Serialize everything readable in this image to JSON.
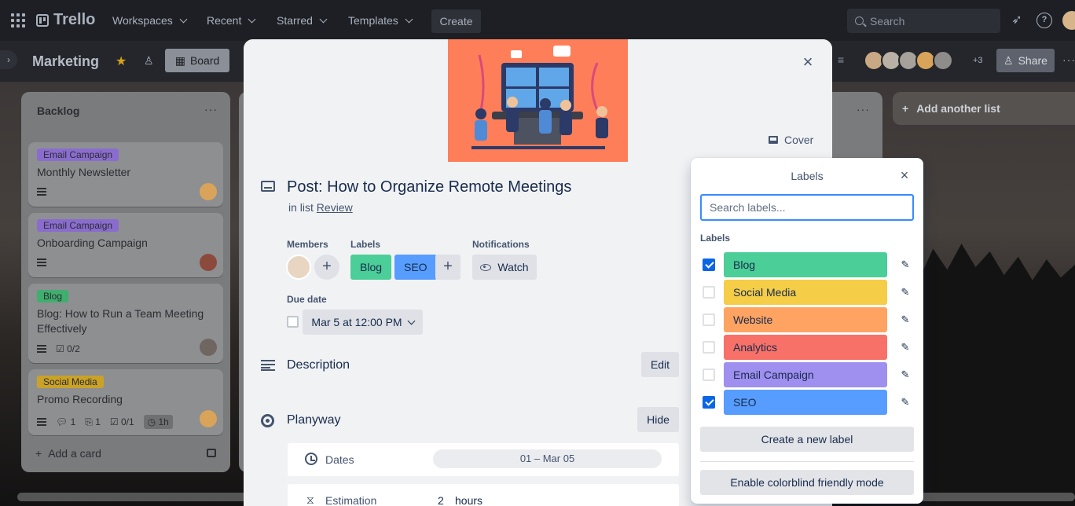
{
  "nav": {
    "logo": "Trello",
    "menus": [
      "Workspaces",
      "Recent",
      "Starred",
      "Templates"
    ],
    "create_label": "Create",
    "search_placeholder": "Search"
  },
  "board": {
    "title": "Marketing",
    "view_label": "Board",
    "members_more": "+3",
    "share_label": "Share"
  },
  "lists": [
    {
      "title": "Backlog",
      "cards": [
        {
          "label": "Email Campaign",
          "label_color": "#8a6ccf",
          "title": "Monthly Newsletter",
          "badges": []
        },
        {
          "label": "Email Campaign",
          "label_color": "#8a6ccf",
          "title": "Onboarding Campaign",
          "badges": []
        },
        {
          "label": "Blog",
          "label_color": "#3fae6f",
          "title": "Blog: How to Run a Team Meeting Effectively",
          "badges": [
            "0/2"
          ]
        },
        {
          "label": "Social Media",
          "label_color": "#c9a227",
          "title": "Promo Recording",
          "badges": [
            "1",
            "1",
            "0/1",
            "1h"
          ]
        }
      ],
      "add_card": "Add a card"
    }
  ],
  "add_list": "Add another list",
  "card_modal": {
    "cover_button": "Cover",
    "title": "Post: How to Organize Remote Meetings",
    "in_list_prefix": "in list",
    "list_name": "Review",
    "members_heading": "Members",
    "labels_heading": "Labels",
    "notifications_heading": "Notifications",
    "labels": [
      {
        "name": "Blog",
        "color": "#4bce97"
      },
      {
        "name": "SEO",
        "color": "#579dff"
      }
    ],
    "watch_label": "Watch",
    "due_date_heading": "Due date",
    "due_date_value": "Mar 5 at 12:00 PM",
    "description_heading": "Description",
    "edit_label": "Edit",
    "planyway_heading": "Planyway",
    "hide_label": "Hide",
    "dates_label": "Dates",
    "dates_value": "01 – Mar 05",
    "estimation_label": "Estimation",
    "estimation_value": "2",
    "estimation_unit": "hours"
  },
  "labels_popover": {
    "title": "Labels",
    "search_placeholder": "Search labels...",
    "section_heading": "Labels",
    "labels": [
      {
        "name": "Blog",
        "color": "#4bce97",
        "checked": true
      },
      {
        "name": "Social Media",
        "color": "#f5cd47",
        "checked": false
      },
      {
        "name": "Website",
        "color": "#fea362",
        "checked": false
      },
      {
        "name": "Analytics",
        "color": "#f87168",
        "checked": false
      },
      {
        "name": "Email Campaign",
        "color": "#9f8fef",
        "checked": false
      },
      {
        "name": "SEO",
        "color": "#579dff",
        "checked": true
      }
    ],
    "create_label": "Create a new label",
    "colorblind_label": "Enable colorblind friendly mode"
  }
}
